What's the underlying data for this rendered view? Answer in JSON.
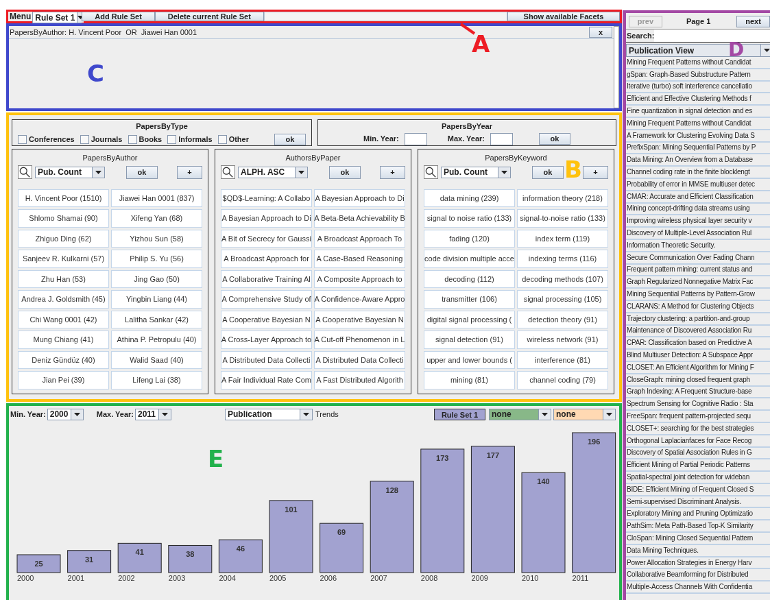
{
  "toolbar": {
    "annotation": {
      "label": "A",
      "color": "#ed1c24"
    },
    "menu_label": "Menu",
    "rule_set": "Rule Set 1",
    "buttons": [
      "Add Rule Set",
      "Delete current Rule Set"
    ],
    "facets_button": "Show available Facets"
  },
  "filters": {
    "annotation": {
      "label": "C",
      "color": "#3f48cc"
    },
    "items": [
      {
        "text": "PapersByAuthor: H. Vincent Poor  OR  Jiawei Han 0001",
        "close": "x"
      }
    ]
  },
  "facets": {
    "annotation": {
      "label": "B",
      "color": "#ffc20e"
    },
    "by_type": {
      "title": "PapersByType",
      "options": [
        {
          "label": "Conferences",
          "checked": false
        },
        {
          "label": "Journals",
          "checked": false
        },
        {
          "label": "Books",
          "checked": false
        },
        {
          "label": "Informals",
          "checked": false
        },
        {
          "label": "Other",
          "checked": false
        }
      ],
      "ok": "ok"
    },
    "by_year": {
      "title": "PapersByYear",
      "min_label": "Min. Year:",
      "max_label": "Max. Year:",
      "ok": "ok"
    },
    "panels": [
      {
        "title": "PapersByAuthor",
        "sort": "Pub. Count",
        "ok": "ok",
        "add": "+",
        "items": [
          "H. Vincent Poor (1510)",
          "Jiawei Han 0001 (837)",
          "Shlomo Shamai (90)",
          "Xifeng Yan (68)",
          "Zhiguo Ding (62)",
          "Yizhou Sun (58)",
          "Sanjeev R. Kulkarni (57)",
          "Philip S. Yu (56)",
          "Zhu Han (53)",
          "Jing Gao (50)",
          "Andrea J. Goldsmith (45)",
          "Yingbin Liang (44)",
          "Chi Wang 0001 (42)",
          "Lalitha Sankar (42)",
          "Mung Chiang (41)",
          "Athina P. Petropulu (40)",
          "Deniz Gündüz (40)",
          "Walid Saad (40)",
          "Jian Pei (39)",
          "Lifeng Lai (38)"
        ]
      },
      {
        "title": "AuthorsByPaper",
        "sort": "ALPH. ASC",
        "ok": "ok",
        "add": "+",
        "items": [
          "$QD$-Learning: A Collabo",
          "A Bayesian Approach to Di",
          "A Bayesian Approach to Di",
          "A Beta-Beta Achievability B",
          "A Bit of Secrecy for Gaussi",
          "A Broadcast Approach To",
          "A Broadcast Approach for",
          "A Case-Based Reasoning",
          "A Collaborative Training Al",
          "A Composite Approach to",
          "A Comprehensive Study of",
          "A Confidence-Aware Appro",
          "A Cooperative Bayesian N",
          "A Cooperative Bayesian N",
          "A Cross-Layer Approach to",
          "A Cut-off Phenomenon in L",
          "A Distributed Data Collecti",
          "A Distributed Data Collecti",
          "A Fair Individual Rate Com",
          "A Fast Distributed Algorith"
        ]
      },
      {
        "title": "PapersByKeyword",
        "sort": "Pub. Count",
        "ok": "ok",
        "add": "+",
        "items": [
          "data mining (239)",
          "information theory (218)",
          "signal to noise ratio (133)",
          "signal-to-noise ratio (133)",
          "fading (120)",
          "index term (119)",
          "code division multiple acce",
          "indexing terms (116)",
          "decoding (112)",
          "decoding methods (107)",
          "transmitter (106)",
          "signal processing (105)",
          "digital signal processing (",
          "detection theory (91)",
          "signal detection (91)",
          "wireless network (91)",
          "upper and lower bounds (",
          "interference (81)",
          "mining (81)",
          "channel coding (79)"
        ]
      }
    ]
  },
  "trends": {
    "annotation": {
      "label": "E",
      "color": "#22b14c"
    },
    "min_label": "Min. Year:",
    "min_value": "2000",
    "max_label": "Max. Year:",
    "max_value": "2011",
    "measure": "Publication",
    "trends_label": "Trends",
    "compare": [
      {
        "value": "none",
        "color": "#88b888"
      },
      {
        "value": "none",
        "color": "#ffd9b3"
      }
    ],
    "chart_data": {
      "type": "bar",
      "categories": [
        "2000",
        "2001",
        "2002",
        "2003",
        "2004",
        "2005",
        "2006",
        "2007",
        "2008",
        "2009",
        "2010",
        "2011"
      ],
      "series": [
        {
          "name": "Rule Set 1",
          "color": "#a2a2d0",
          "values": [
            25,
            31,
            41,
            38,
            46,
            101,
            69,
            128,
            173,
            177,
            140,
            196
          ]
        }
      ],
      "data_labels": true
    }
  },
  "results": {
    "annotation": {
      "label": "D",
      "color": "#a349a4"
    },
    "prev": {
      "label": "prev",
      "disabled": true
    },
    "page": "Page 1",
    "next": {
      "label": "next",
      "disabled": false
    },
    "search_label": "Search:",
    "view": "Publication View",
    "items": [
      "Mining Frequent Patterns without Candidat",
      "gSpan: Graph-Based Substructure Pattern",
      "Iterative (turbo) soft interference cancellatio",
      "Efficient and Effective Clustering Methods f",
      "Fine quantization in signal detection and es",
      "Mining Frequent Patterns without Candidat",
      "A Framework for Clustering Evolving Data S",
      "PrefixSpan: Mining Sequential Patterns by P",
      "Data Mining: An Overview from a Database",
      "Channel coding rate in the finite blocklengt",
      "Probability of error in MMSE multiuser detec",
      "CMAR: Accurate and Efficient Classification",
      "Mining concept-drifting data streams using",
      "Improving wireless physical layer security v",
      "Discovery of Multiple-Level Association Rul",
      "Information Theoretic Security.",
      "Secure Communication Over Fading Chann",
      "Frequent pattern mining: current status and",
      "Graph Regularized Nonnegative Matrix Fac",
      "Mining Sequential Patterns by Pattern-Grow",
      "CLARANS: A Method for Clustering Objects",
      "Trajectory clustering: a partition-and-group",
      "Maintenance of Discovered Association Ru",
      "CPAR: Classification based on Predictive A",
      "Blind Multiuser Detection: A Subspace Appr",
      "CLOSET: An Efficient Algorithm for Mining F",
      "CloseGraph: mining closed frequent graph",
      "Graph Indexing: A Frequent Structure-base",
      "Spectrum Sensing for Cognitive Radio : Sta",
      "FreeSpan: frequent pattern-projected sequ",
      "CLOSET+: searching for the best strategies",
      "Orthogonal Laplacianfaces for Face Recog",
      "Discovery of Spatial Association Rules in G",
      "Efficient Mining of Partial Periodic Patterns",
      "Spatial-spectral joint detection for wideban",
      "BIDE: Efficient Mining of Frequent Closed S",
      "Semi-supervised Discriminant Analysis.",
      "Exploratory Mining and Pruning Optimizatio",
      "PathSim: Meta Path-Based Top-K Similarity",
      "CloSpan: Mining Closed Sequential Pattern",
      "Data Mining Techniques.",
      "Power Allocation Strategies in Energy Harv",
      "Collaborative Beamforming for Distributed",
      "Multiple-Access Channels With Confidentia"
    ]
  }
}
